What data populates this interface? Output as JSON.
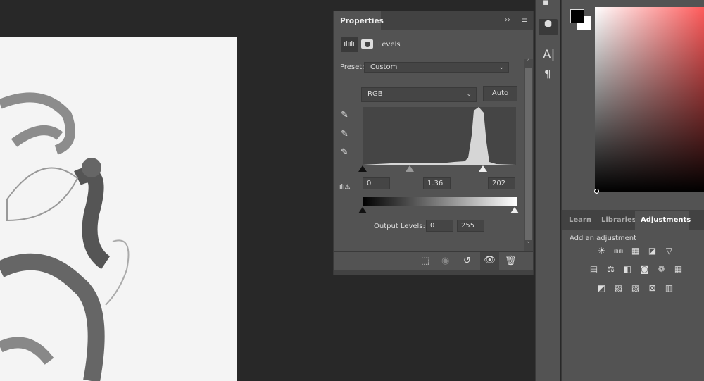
{
  "properties_panel": {
    "tab_label": "Properties",
    "collapse_icon": "double-chevron-right-icon",
    "menu_icon": "hamburger-menu-icon",
    "adjustment_name": "Levels",
    "preset_label": "Preset:",
    "preset_value": "Custom",
    "channel_value": "RGB",
    "auto_label": "Auto",
    "input_black": "0",
    "input_gamma": "1.36",
    "input_white": "202",
    "output_label": "Output Levels:",
    "output_black": "0",
    "output_white": "255",
    "input_levels": {
      "black": 0,
      "gamma": 1.36,
      "white": 202
    },
    "footer_icons": [
      "clip-to-layer-icon",
      "view-previous-state-icon",
      "reset-icon",
      "visibility-eye-icon",
      "trash-icon"
    ]
  },
  "color": {
    "foreground": "#000000",
    "background": "#ffffff",
    "hue": "#ff5a5a"
  },
  "adjustments_panel": {
    "tabs": [
      {
        "label": "Learn"
      },
      {
        "label": "Libraries"
      },
      {
        "label": "Adjustments",
        "active": true
      }
    ],
    "heading": "Add an adjustment",
    "rows": [
      [
        "brightness-contrast-icon",
        "levels-icon",
        "curves-icon",
        "exposure-icon",
        "vibrance-icon"
      ],
      [
        "hue-saturation-icon",
        "color-balance-icon",
        "black-white-icon",
        "photo-filter-icon",
        "channel-mixer-icon",
        "color-lookup-icon"
      ],
      [
        "invert-icon",
        "posterize-icon",
        "threshold-icon",
        "selective-color-icon",
        "gradient-map-icon"
      ]
    ]
  }
}
